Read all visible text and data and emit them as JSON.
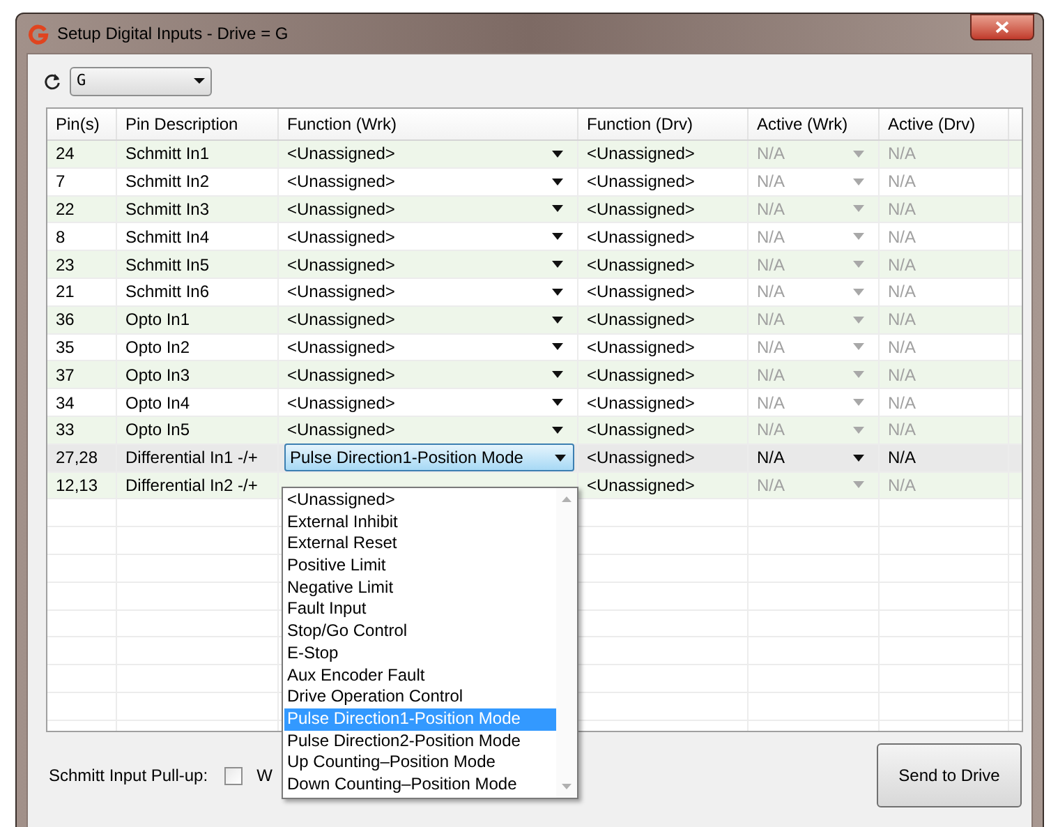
{
  "window": {
    "title": "Setup Digital Inputs - Drive = G"
  },
  "drive_select": {
    "value": "G"
  },
  "table": {
    "columns": [
      "Pin(s)",
      "Pin Description",
      "Function (Wrk)",
      "Function (Drv)",
      "Active (Wrk)",
      "Active (Drv)"
    ],
    "rows": [
      {
        "pins": "24",
        "description": "Schmitt In1",
        "function_wrk": "<Unassigned>",
        "function_drv": "<Unassigned>",
        "active_wrk": "N/A",
        "active_drv": "N/A",
        "active_enabled": false,
        "selected": false
      },
      {
        "pins": "7",
        "description": "Schmitt In2",
        "function_wrk": "<Unassigned>",
        "function_drv": "<Unassigned>",
        "active_wrk": "N/A",
        "active_drv": "N/A",
        "active_enabled": false,
        "selected": false
      },
      {
        "pins": "22",
        "description": "Schmitt In3",
        "function_wrk": "<Unassigned>",
        "function_drv": "<Unassigned>",
        "active_wrk": "N/A",
        "active_drv": "N/A",
        "active_enabled": false,
        "selected": false
      },
      {
        "pins": "8",
        "description": "Schmitt In4",
        "function_wrk": "<Unassigned>",
        "function_drv": "<Unassigned>",
        "active_wrk": "N/A",
        "active_drv": "N/A",
        "active_enabled": false,
        "selected": false
      },
      {
        "pins": "23",
        "description": "Schmitt In5",
        "function_wrk": "<Unassigned>",
        "function_drv": "<Unassigned>",
        "active_wrk": "N/A",
        "active_drv": "N/A",
        "active_enabled": false,
        "selected": false
      },
      {
        "pins": "21",
        "description": "Schmitt In6",
        "function_wrk": "<Unassigned>",
        "function_drv": "<Unassigned>",
        "active_wrk": "N/A",
        "active_drv": "N/A",
        "active_enabled": false,
        "selected": false
      },
      {
        "pins": "36",
        "description": "Opto In1",
        "function_wrk": "<Unassigned>",
        "function_drv": "<Unassigned>",
        "active_wrk": "N/A",
        "active_drv": "N/A",
        "active_enabled": false,
        "selected": false
      },
      {
        "pins": "35",
        "description": "Opto In2",
        "function_wrk": "<Unassigned>",
        "function_drv": "<Unassigned>",
        "active_wrk": "N/A",
        "active_drv": "N/A",
        "active_enabled": false,
        "selected": false
      },
      {
        "pins": "37",
        "description": "Opto In3",
        "function_wrk": "<Unassigned>",
        "function_drv": "<Unassigned>",
        "active_wrk": "N/A",
        "active_drv": "N/A",
        "active_enabled": false,
        "selected": false
      },
      {
        "pins": "34",
        "description": "Opto In4",
        "function_wrk": "<Unassigned>",
        "function_drv": "<Unassigned>",
        "active_wrk": "N/A",
        "active_drv": "N/A",
        "active_enabled": false,
        "selected": false
      },
      {
        "pins": "33",
        "description": "Opto In5",
        "function_wrk": "<Unassigned>",
        "function_drv": "<Unassigned>",
        "active_wrk": "N/A",
        "active_drv": "N/A",
        "active_enabled": false,
        "selected": false
      },
      {
        "pins": "27,28",
        "description": "Differential In1 -/+",
        "function_wrk": "Pulse Direction1-Position Mode",
        "function_drv": "<Unassigned>",
        "active_wrk": "N/A",
        "active_drv": "N/A",
        "active_enabled": true,
        "selected": true
      },
      {
        "pins": "12,13",
        "description": "Differential In2 -/+",
        "function_drv": "<Unassigned>",
        "active_wrk": "N/A",
        "active_drv": "N/A",
        "active_enabled": false,
        "selected": false
      }
    ]
  },
  "function_dropdown": {
    "items": [
      {
        "label": "<Unassigned>",
        "selected": false
      },
      {
        "label": "External Inhibit",
        "selected": false
      },
      {
        "label": "External Reset",
        "selected": false
      },
      {
        "label": "Positive Limit",
        "selected": false
      },
      {
        "label": "Negative Limit",
        "selected": false
      },
      {
        "label": "Fault Input",
        "selected": false
      },
      {
        "label": "Stop/Go Control",
        "selected": false
      },
      {
        "label": "E-Stop",
        "selected": false
      },
      {
        "label": "Aux Encoder Fault",
        "selected": false
      },
      {
        "label": "Drive Operation Control",
        "selected": false
      },
      {
        "label": "Pulse Direction1-Position Mode",
        "selected": true
      },
      {
        "label": "Pulse Direction2-Position Mode",
        "selected": false
      },
      {
        "label": "Up Counting–Position Mode",
        "selected": false
      },
      {
        "label": "Down Counting–Position Mode",
        "selected": false
      }
    ]
  },
  "pullup": {
    "label": "Schmitt Input Pull-up:",
    "checked": false,
    "option_text": "W"
  },
  "send_button": "Send to Drive"
}
